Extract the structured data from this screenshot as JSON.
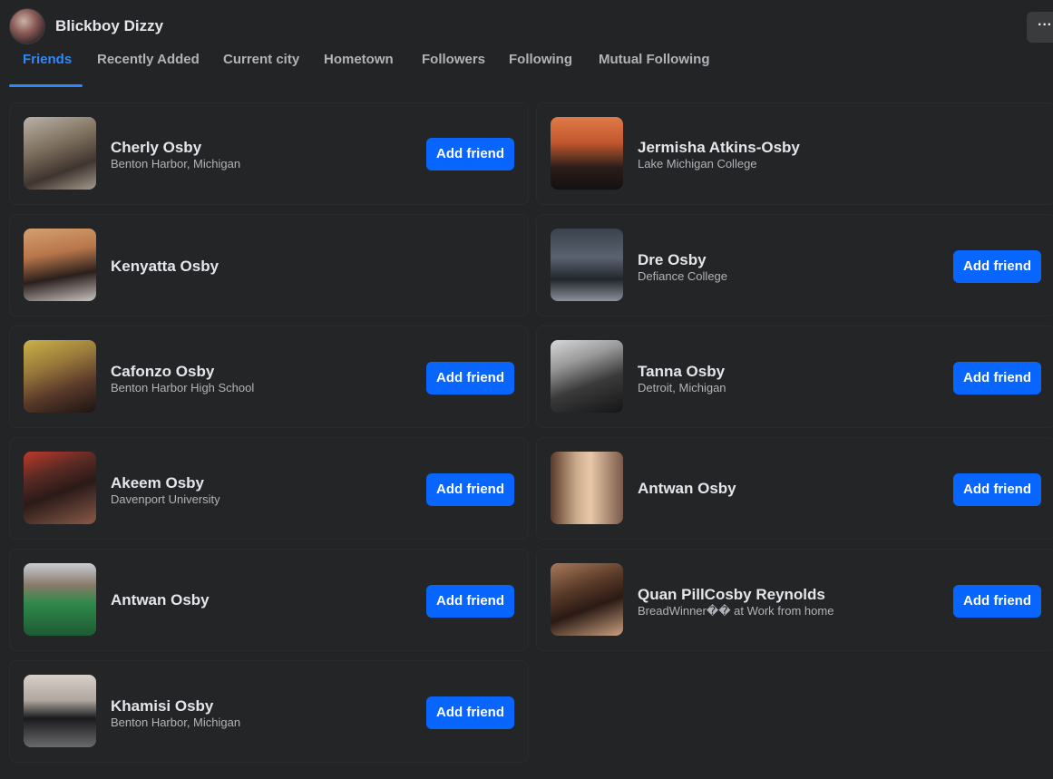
{
  "profile": {
    "name": "Blickboy Dizzy",
    "more_label": "···"
  },
  "tabs": [
    {
      "label": "Friends",
      "active": true
    },
    {
      "label": "Recently Added"
    },
    {
      "label": "Current city"
    },
    {
      "label": "Hometown"
    },
    {
      "label": "Followers"
    },
    {
      "label": "Following"
    },
    {
      "label": "Mutual Following"
    }
  ],
  "friends": [
    {
      "name": "Cherly Osby",
      "subtitle": "Benton Harbor, Michigan",
      "button": "Add friend"
    },
    {
      "name": "Jermisha Atkins-Osby",
      "subtitle": "Lake Michigan College",
      "button": ""
    },
    {
      "name": "Kenyatta Osby",
      "subtitle": "",
      "button": ""
    },
    {
      "name": "Dre Osby",
      "subtitle": "Defiance College",
      "button": "Add friend"
    },
    {
      "name": "Cafonzo Osby",
      "subtitle": "Benton Harbor High School",
      "button": "Add friend"
    },
    {
      "name": "Tanna Osby",
      "subtitle": "Detroit, Michigan",
      "button": "Add friend"
    },
    {
      "name": "Akeem Osby",
      "subtitle": "Davenport University",
      "button": "Add friend"
    },
    {
      "name": "Antwan Osby",
      "subtitle": "",
      "button": "Add friend"
    },
    {
      "name": "Antwan Osby",
      "subtitle": "",
      "button": "Add friend"
    },
    {
      "name": "Quan PillCosby Reynolds",
      "subtitle": "BreadWinner�� at Work from home",
      "button": "Add friend"
    },
    {
      "name": "Khamisi Osby",
      "subtitle": "Benton Harbor, Michigan",
      "button": "Add friend"
    }
  ],
  "colors": {
    "accent": "#2d88ff",
    "button": "#0866ff",
    "background": "#232426"
  }
}
